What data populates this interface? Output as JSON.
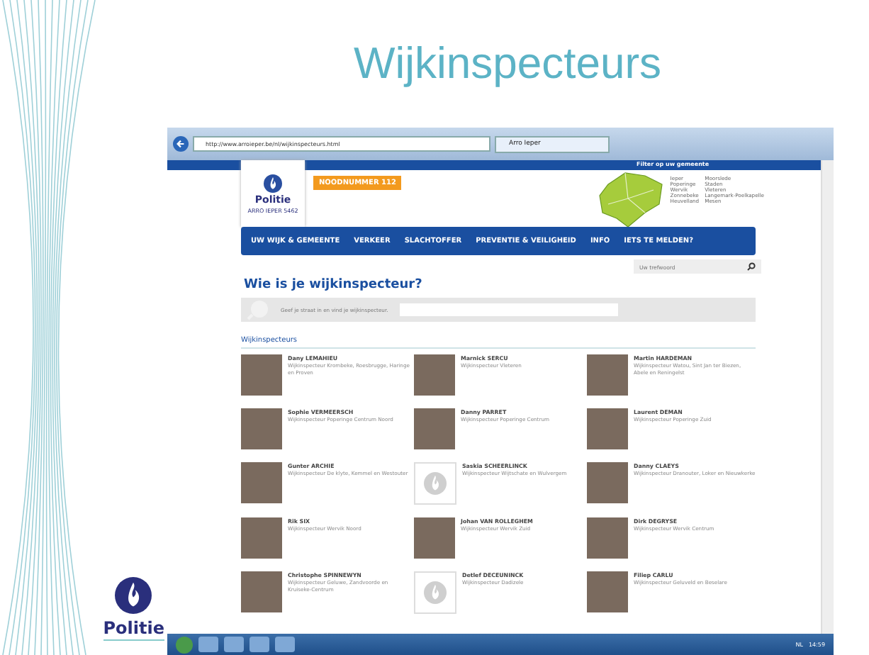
{
  "slide": {
    "title": "Wijkinspecteurs",
    "footer_logo": "Politie"
  },
  "browser": {
    "url": "http://www.arroieper.be/nl/wijkinspecteurs.html",
    "tab": "Arro Ieper"
  },
  "site": {
    "logo": "Politie",
    "logo_sub": "ARRO IEPER 5462",
    "emergency": "NOODNUMMER 112",
    "filter_title": "Filter op uw gemeente",
    "municipalities": [
      [
        "Ieper",
        "Poperinge",
        "Wervik",
        "Zonnebeke",
        "Heuvelland"
      ],
      [
        "Moorslede",
        "Staden",
        "Vleteren",
        "Langemark-Poelkapelle",
        "Mesen"
      ]
    ],
    "nav": [
      "UW WIJK & GEMEENTE",
      "VERKEER",
      "SLACHTOFFER",
      "PREVENTIE & VEILIGHEID",
      "INFO",
      "IETS TE MELDEN?"
    ],
    "search": {
      "placeholder": "Uw trefwoord"
    },
    "heading": "Wie is je wijkinspecteur?",
    "finder_hint": "Geef je straat in en vind je wijkinspecteur.",
    "section": "Wijkinspecteurs",
    "inspectors": [
      {
        "name": "Dany LEMAHIEU",
        "area": "Wijkinspecteur Krombeke, Roesbrugge, Haringe en Proven",
        "kind": "photo"
      },
      {
        "name": "Marnick SERCU",
        "area": "Wijkinspecteur Vleteren",
        "kind": "photo"
      },
      {
        "name": "Martin HARDEMAN",
        "area": "Wijkinspecteur Watou, Sint Jan ter Biezen, Abele en Reningelst",
        "kind": "photo"
      },
      {
        "name": "Sophie VERMEERSCH",
        "area": "Wijkinspecteur Poperinge Centrum Noord",
        "kind": "photo"
      },
      {
        "name": "Danny PARRET",
        "area": "Wijkinspecteur Poperinge Centrum",
        "kind": "photo"
      },
      {
        "name": "Laurent DEMAN",
        "area": "Wijkinspecteur Poperinge Zuid",
        "kind": "photo"
      },
      {
        "name": "Gunter ARCHIE",
        "area": "Wijkinspecteur De klyte, Kemmel en Westouter",
        "kind": "photo"
      },
      {
        "name": "Saskia SCHEERLINCK",
        "area": "Wijkinspecteur Wijtschate en Wulvergem",
        "kind": "logo"
      },
      {
        "name": "Danny CLAEYS",
        "area": "Wijkinspecteur Dranouter, Loker en Nieuwkerke",
        "kind": "photo"
      },
      {
        "name": "Rik SIX",
        "area": "Wijkinspecteur Wervik Noord",
        "kind": "photo"
      },
      {
        "name": "Johan VAN ROLLEGHEM",
        "area": "Wijkinspecteur Wervik Zuid",
        "kind": "photo"
      },
      {
        "name": "Dirk DEGRYSE",
        "area": "Wijkinspecteur Wervik Centrum",
        "kind": "photo"
      },
      {
        "name": "Christophe SPINNEWYN",
        "area": "Wijkinspecteur Geluwe, Zandvoorde en Kruiseke-Centrum",
        "kind": "photo"
      },
      {
        "name": "Detlef DECEUNINCK",
        "area": "Wijkinspecteur Dadizele",
        "kind": "logo"
      },
      {
        "name": "Filiep CARLU",
        "area": "Wijkinspecteur Geluveld en Beselare",
        "kind": "photo"
      }
    ]
  },
  "taskbar": {
    "language": "NL",
    "clock": "14:59"
  }
}
